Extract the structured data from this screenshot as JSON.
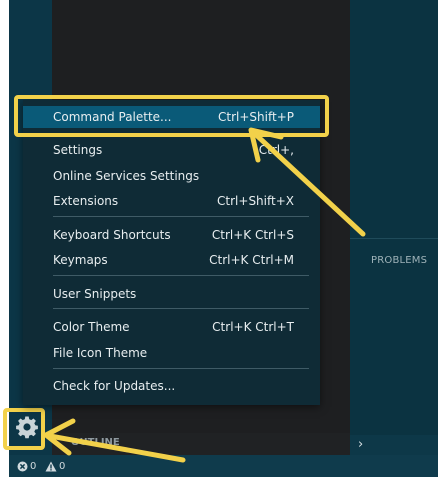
{
  "menu": {
    "items": [
      {
        "label": "Command Palette...",
        "shortcut": "Ctrl+Shift+P"
      },
      {
        "label": "Settings",
        "shortcut": "Ctrl+,"
      },
      {
        "label": "Online Services Settings",
        "shortcut": ""
      },
      {
        "label": "Extensions",
        "shortcut": "Ctrl+Shift+X"
      },
      {
        "label": "Keyboard Shortcuts",
        "shortcut": "Ctrl+K Ctrl+S"
      },
      {
        "label": "Keymaps",
        "shortcut": "Ctrl+K Ctrl+M"
      },
      {
        "label": "User Snippets",
        "shortcut": ""
      },
      {
        "label": "Color Theme",
        "shortcut": "Ctrl+K Ctrl+T"
      },
      {
        "label": "File Icon Theme",
        "shortcut": ""
      },
      {
        "label": "Check for Updates...",
        "shortcut": ""
      }
    ]
  },
  "panel": {
    "problems_label": "PROBLEMS",
    "chevron": "›"
  },
  "sidebar": {
    "outline_label": "OUTLINE"
  },
  "status_bar": {
    "errors": "0",
    "warnings": "0"
  },
  "icons": {
    "gear": "gear-icon",
    "error": "error-icon",
    "warning": "warning-icon",
    "chevron": "chevron-right-icon"
  },
  "colors": {
    "highlight": "#f2d14a",
    "menu_background": "#0f2b36",
    "menu_selected": "#0a5a78",
    "activity_bar": "#0c3647",
    "status_bar": "#0f3b4c"
  }
}
